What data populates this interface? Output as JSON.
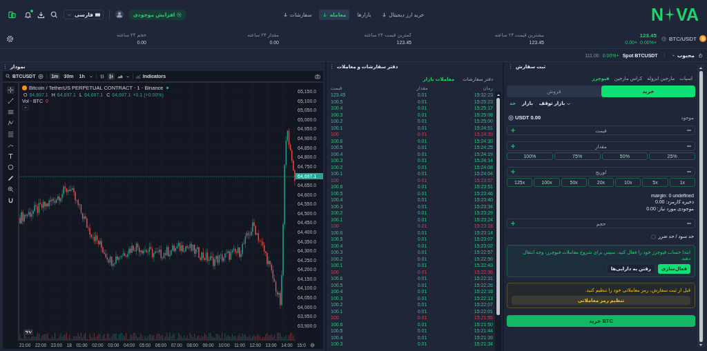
{
  "header": {
    "logo_left": "N",
    "logo_right": "VA",
    "nav": [
      {
        "label": "خرید ارز دیجیتال",
        "has_menu": true,
        "selected": false
      },
      {
        "label": "بازارها",
        "has_menu": false,
        "selected": false
      },
      {
        "label": "معامله",
        "has_menu": true,
        "selected": true
      },
      {
        "label": "سفارشات",
        "has_menu": true,
        "selected": false
      }
    ],
    "deposit_button": "افزایش موجودی",
    "language": "فارسی"
  },
  "ticker": {
    "pair": "BTC/USDT",
    "price": "123.45",
    "change": "0.00+",
    "change_percent": "0.00%+"
  },
  "stats": {
    "high_24h": {
      "label": "بیشترین قیمت ۲۴ ساعته",
      "value": "123.45"
    },
    "low_24h": {
      "label": "کمترین قیمت ۲۴ ساعته",
      "value": "123.45"
    },
    "amount_24h": {
      "label": "مقدار ۲۴ ساعته",
      "value": "0.00"
    },
    "volume_24h": {
      "label": "حجم ۲۴ ساعته",
      "value": "0.00"
    }
  },
  "favorites": {
    "label": "محبوب",
    "market": "Spot BTCUSDT",
    "change": "0.00%+",
    "price": "111.00"
  },
  "chart_panel": {
    "title": "نمودار",
    "symbol": "BTCUSDT",
    "intervals": [
      {
        "label": "1m",
        "selected": true
      },
      {
        "label": "30m",
        "selected": false
      },
      {
        "label": "1h",
        "selected": false
      }
    ],
    "indicators": "Indicators",
    "legend_title": "Bitcoin / TetherUS PERPETUAL CONTRACT · 1 · Binance",
    "ohlc": [
      {
        "key": "O",
        "value": "64,697.1"
      },
      {
        "key": "H",
        "value": "64,697.1"
      },
      {
        "key": "L",
        "value": "64,697.1"
      },
      {
        "key": "C",
        "value": "64,697.1"
      }
    ],
    "change": "+0.1 (+0.00%)",
    "volume_label": "Vol · BTC",
    "volume_value": "0",
    "price_ticks": [
      {
        "label": "65,150.0",
        "kind": "tick"
      },
      {
        "label": "65,100.0",
        "kind": "tick"
      },
      {
        "label": "65,050.0",
        "kind": "tick"
      },
      {
        "label": "65,000.0",
        "kind": "tick"
      },
      {
        "label": "64,950.0",
        "kind": "tick"
      },
      {
        "label": "64,900.0",
        "kind": "tick"
      },
      {
        "label": "64,850.0",
        "kind": "tick"
      },
      {
        "label": "64,800.0",
        "kind": "tick"
      },
      {
        "label": "64,750.0",
        "kind": "tick"
      },
      {
        "label": "64,697.1",
        "kind": "current"
      },
      {
        "label": "64,650.0",
        "kind": "tick"
      },
      {
        "label": "64,600.0",
        "kind": "tick"
      },
      {
        "label": "64,550.0",
        "kind": "tick"
      },
      {
        "label": "64,500.0",
        "kind": "tick"
      },
      {
        "label": "64,450.0",
        "kind": "tick"
      },
      {
        "label": "64,400.0",
        "kind": "tick"
      },
      {
        "label": "64,350.0",
        "kind": "tick"
      },
      {
        "label": "64,300.0",
        "kind": "tick"
      },
      {
        "label": "64,250.0",
        "kind": "tick"
      },
      {
        "label": "64,200.0",
        "kind": "tick"
      },
      {
        "label": "64,150.0",
        "kind": "tick"
      },
      {
        "label": "64,100.0",
        "kind": "tick"
      },
      {
        "label": "64,050.0",
        "kind": "tick"
      },
      {
        "label": "64,000.0",
        "kind": "tick"
      },
      {
        "label": "63,950.0",
        "kind": "tick"
      },
      {
        "label": "63,900.0",
        "kind": "tick"
      }
    ],
    "time_ticks": [
      "21:00",
      "22:00",
      "23:00",
      "18",
      "01:00",
      "02:00",
      "03:00",
      "04:00",
      "05:00",
      "06:00",
      "07:00",
      "08:00",
      "09:00",
      "10:00",
      "11:00",
      "12:00",
      "13:00",
      "14:00",
      "15:0"
    ]
  },
  "trades_panel": {
    "title": "دفتر سفارشات و معاملات",
    "tabs": [
      {
        "label": "دفتر سفارشات",
        "selected": false
      },
      {
        "label": "معاملات بازار",
        "selected": true
      }
    ],
    "columns": [
      "زمان",
      "مقدار",
      "قیمت"
    ],
    "rows": [
      {
        "time": "15:32:23",
        "amount": "0.01",
        "price": "123.45",
        "sell": false
      },
      {
        "time": "15:25:23",
        "amount": "0.01",
        "price": "100.5",
        "sell": false
      },
      {
        "time": "15:25:17",
        "amount": "0.01",
        "price": "100.4",
        "sell": false
      },
      {
        "time": "15:25:08",
        "amount": "0.01",
        "price": "100.3",
        "sell": false
      },
      {
        "time": "15:25:00",
        "amount": "0.01",
        "price": "100.2",
        "sell": false
      },
      {
        "time": "15:24:51",
        "amount": "0.01",
        "price": "100.1",
        "sell": false
      },
      {
        "time": "15:24:39",
        "amount": "0.01",
        "price": "100",
        "sell": true
      },
      {
        "time": "15:24:30",
        "amount": "0.01",
        "price": "100.6",
        "sell": false
      },
      {
        "time": "15:24:25",
        "amount": "0.01",
        "price": "100.5",
        "sell": false
      },
      {
        "time": "15:24:19",
        "amount": "0.01",
        "price": "100.4",
        "sell": false
      },
      {
        "time": "15:24:14",
        "amount": "0.01",
        "price": "100.3",
        "sell": false
      },
      {
        "time": "15:24:08",
        "amount": "0.01",
        "price": "100.2",
        "sell": false
      },
      {
        "time": "15:24:04",
        "amount": "0.01",
        "price": "100.1",
        "sell": false
      },
      {
        "time": "15:23:57",
        "amount": "0.01",
        "price": "100",
        "sell": true
      },
      {
        "time": "15:23:51",
        "amount": "0.01",
        "price": "100.6",
        "sell": false
      },
      {
        "time": "15:23:46",
        "amount": "0.01",
        "price": "100.5",
        "sell": false
      },
      {
        "time": "15:23:40",
        "amount": "0.01",
        "price": "100.4",
        "sell": false
      },
      {
        "time": "15:23:34",
        "amount": "0.01",
        "price": "100.3",
        "sell": false
      },
      {
        "time": "15:23:29",
        "amount": "0.01",
        "price": "100.2",
        "sell": false
      },
      {
        "time": "15:23:24",
        "amount": "0.01",
        "price": "100.1",
        "sell": false
      },
      {
        "time": "15:23:18",
        "amount": "0.01",
        "price": "100",
        "sell": true
      },
      {
        "time": "15:23:14",
        "amount": "0.01",
        "price": "100.6",
        "sell": false
      },
      {
        "time": "15:23:07",
        "amount": "0.01",
        "price": "100.5",
        "sell": false
      },
      {
        "time": "15:23:02",
        "amount": "0.01",
        "price": "100.4",
        "sell": false
      },
      {
        "time": "15:22:57",
        "amount": "0.01",
        "price": "100.3",
        "sell": false
      },
      {
        "time": "15:22:50",
        "amount": "0.01",
        "price": "100.2",
        "sell": false
      },
      {
        "time": "15:22:43",
        "amount": "0.01",
        "price": "100.1",
        "sell": false
      },
      {
        "time": "15:22:36",
        "amount": "0.01",
        "price": "100",
        "sell": true
      },
      {
        "time": "15:22:31",
        "amount": "0.01",
        "price": "100.6",
        "sell": false
      },
      {
        "time": "15:22:26",
        "amount": "0.01",
        "price": "100.5",
        "sell": false
      },
      {
        "time": "15:22:18",
        "amount": "0.01",
        "price": "100.4",
        "sell": false
      },
      {
        "time": "15:22:13",
        "amount": "0.01",
        "price": "100.3",
        "sell": false
      },
      {
        "time": "15:22:07",
        "amount": "0.01",
        "price": "100.2",
        "sell": false
      },
      {
        "time": "15:22:01",
        "amount": "0.01",
        "price": "100.1",
        "sell": false
      },
      {
        "time": "15:21:55",
        "amount": "0.01",
        "price": "100",
        "sell": true
      },
      {
        "time": "15:21:50",
        "amount": "0.01",
        "price": "100.6",
        "sell": false
      },
      {
        "time": "15:21:44",
        "amount": "0.01",
        "price": "100.5",
        "sell": false
      },
      {
        "time": "15:21:39",
        "amount": "0.01",
        "price": "100.4",
        "sell": false
      },
      {
        "time": "15:21:34",
        "amount": "0.01",
        "price": "100.3",
        "sell": false
      }
    ]
  },
  "order_panel": {
    "title": "ثبت سفارش",
    "account_tabs": [
      {
        "label": "اسپات",
        "selected": false
      },
      {
        "label": "مارجین ایزوله",
        "selected": false
      },
      {
        "label": "کراس مارجین",
        "selected": false
      },
      {
        "label": "فیوچرز",
        "selected": true
      }
    ],
    "sides": [
      {
        "label": "خرید",
        "selected": true
      },
      {
        "label": "فروش",
        "selected": false
      }
    ],
    "order_types": [
      {
        "label": "بازار توقف",
        "has_menu": true,
        "selected": false
      },
      {
        "label": "بازار",
        "has_menu": false,
        "selected": false
      },
      {
        "label": "حد",
        "has_menu": false,
        "selected": true
      }
    ],
    "available_label": "موجود",
    "available_value": "USDT 0.00",
    "price_placeholder": "قیمت",
    "amount_placeholder": "مقدار",
    "percent_options": [
      "100%",
      "75%",
      "50%",
      "25%"
    ],
    "leverage_placeholder": "لوریج",
    "leverage_options": [
      "125x",
      "100x",
      "50x",
      "20x",
      "10x",
      "5x",
      "1x"
    ],
    "info": [
      "margin: 0 undefined",
      "ذخیره کارمزد: 0.00",
      "موجودی مورد نیاز: 0.00"
    ],
    "volume_placeholder": "حجم",
    "tp_sl": {
      "label": "حد سود / حد ضرر",
      "checked": false
    },
    "futures_notice": {
      "text": "ابتدا حساب فیوچرز خود را فعال کنید. سپس برای شروع معاملات فیوچرز، وجه انتقال دهید.",
      "primary_button": "فعال‌سازی",
      "secondary_button": "رفتن به دارایی‌ها"
    },
    "password_notice": {
      "text": "قبل از ثبت سفارش، رمز معاملاتی خود را تنظیم کنید.",
      "button": "تنظیم رمز معاملاتی"
    },
    "submit": "خرید BTC"
  }
}
